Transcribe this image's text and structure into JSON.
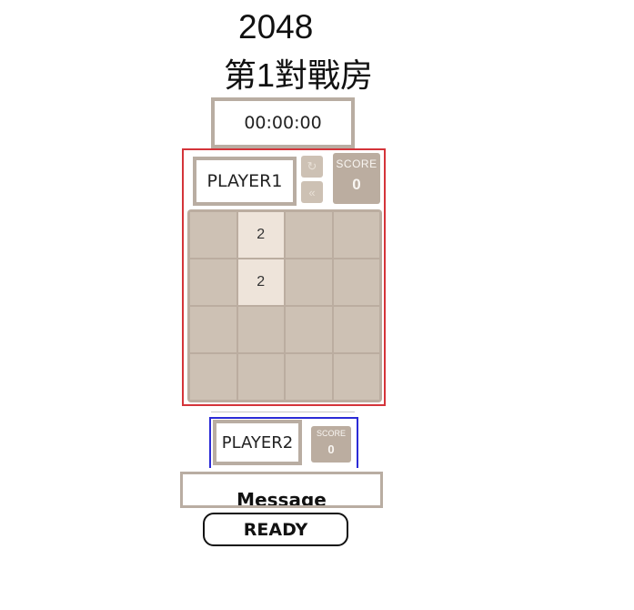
{
  "header": {
    "game_title": "2048",
    "room_title": "第1對戰房"
  },
  "timer": {
    "value": "00:00:00"
  },
  "player1": {
    "name": "PLAYER1",
    "score_label": "SCORE",
    "score": "0",
    "restart_icon": "restart-icon",
    "undo_icon": "rewind-icon",
    "grid": [
      [
        "",
        "2",
        "",
        ""
      ],
      [
        "",
        "2",
        "",
        ""
      ],
      [
        "",
        "",
        "",
        ""
      ],
      [
        "",
        "",
        "",
        ""
      ]
    ]
  },
  "player2": {
    "name": "PLAYER2",
    "score_label": "SCORE",
    "score": "0"
  },
  "message": {
    "text": "Message"
  },
  "actions": {
    "ready_label": "READY"
  },
  "colors": {
    "player1_border": "#d4343a",
    "player2_border": "#2b2bd6",
    "grid_bg": "#bbada0",
    "empty_cell": "#cdc1b4",
    "tile_2": "#eee4da",
    "frame": "#b9ada2"
  }
}
